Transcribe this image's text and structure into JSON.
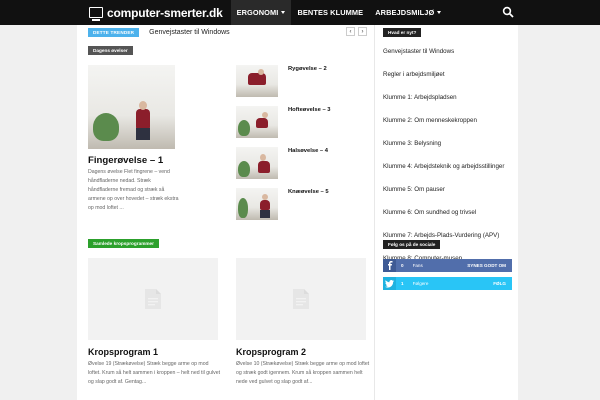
{
  "header": {
    "logo_text": "computer-smerter.dk",
    "menu": [
      {
        "label": "ERGONOMI"
      },
      {
        "label": "BENTES KLUMME"
      },
      {
        "label": "ARBEJDSMILJØ"
      }
    ]
  },
  "trending": {
    "badge": "DETTE TRENDER",
    "text": "Genvejstaster til Windows",
    "prev": "‹",
    "next": "›"
  },
  "block1": {
    "title": "Dagens øvelser",
    "color": "#555555",
    "main": {
      "title": "Fingerøvelse – 1",
      "excerpt": "Dagens øvelse Flet fingrene – vend håndfladerne nedad. Stræk håndfladerne fremad og stræk så armene op over hovedet – stræk ekstra op mod loftet ..."
    },
    "items": [
      {
        "title": "Rygøvelse – 2"
      },
      {
        "title": "Hofteøvelse – 3"
      },
      {
        "title": "Halsøvelse – 4"
      },
      {
        "title": "Knæøvelse – 5"
      }
    ]
  },
  "block2": {
    "title": "Samlede kropsprogrammer",
    "color": "#2ca02c",
    "posts": [
      {
        "title": "Kropsprogram 1",
        "excerpt": "Øvelse 19 (Strækøvelse) Stræk begge arme op mod loftet. Krum så helt sammen i kroppen – helt ned til gulvet og slap godt af. Gentag..."
      },
      {
        "title": "Kropsprogram 2",
        "excerpt": "Øvelse 10 (Strækøvelse) Stræk begge arme op mod loftet og stræk godt igennem. Krum så kroppen sammen helt nede ved gulvet og slap godt af..."
      }
    ]
  },
  "sidebar": {
    "news_title": "Hvad er nyt?",
    "links": [
      "Genvejstaster til Windows",
      "Regler i arbejdsmiljøet",
      "Klumme 1: Arbejdspladsen",
      "Klumme 2: Om menneskekroppen",
      "Klumme 3: Belysning",
      "Klumme 4: Arbejdsteknik og arbejdsstillinger",
      "Klumme 5: Om pauser",
      "Klumme 6: Om sundhed og trivsel",
      "Klumme 7: Arbejds-Plads-Vurdering (APV)",
      "Klumme 8: Computer-musen"
    ],
    "social_title": "Følg os på de sociale",
    "facebook": {
      "count": "0",
      "label": "Fans",
      "action": "SYNES GODT OM",
      "color": "#516eab"
    },
    "twitter": {
      "count": "1",
      "label": "Følgere",
      "action": "FØLG",
      "color": "#29c5f6"
    }
  }
}
